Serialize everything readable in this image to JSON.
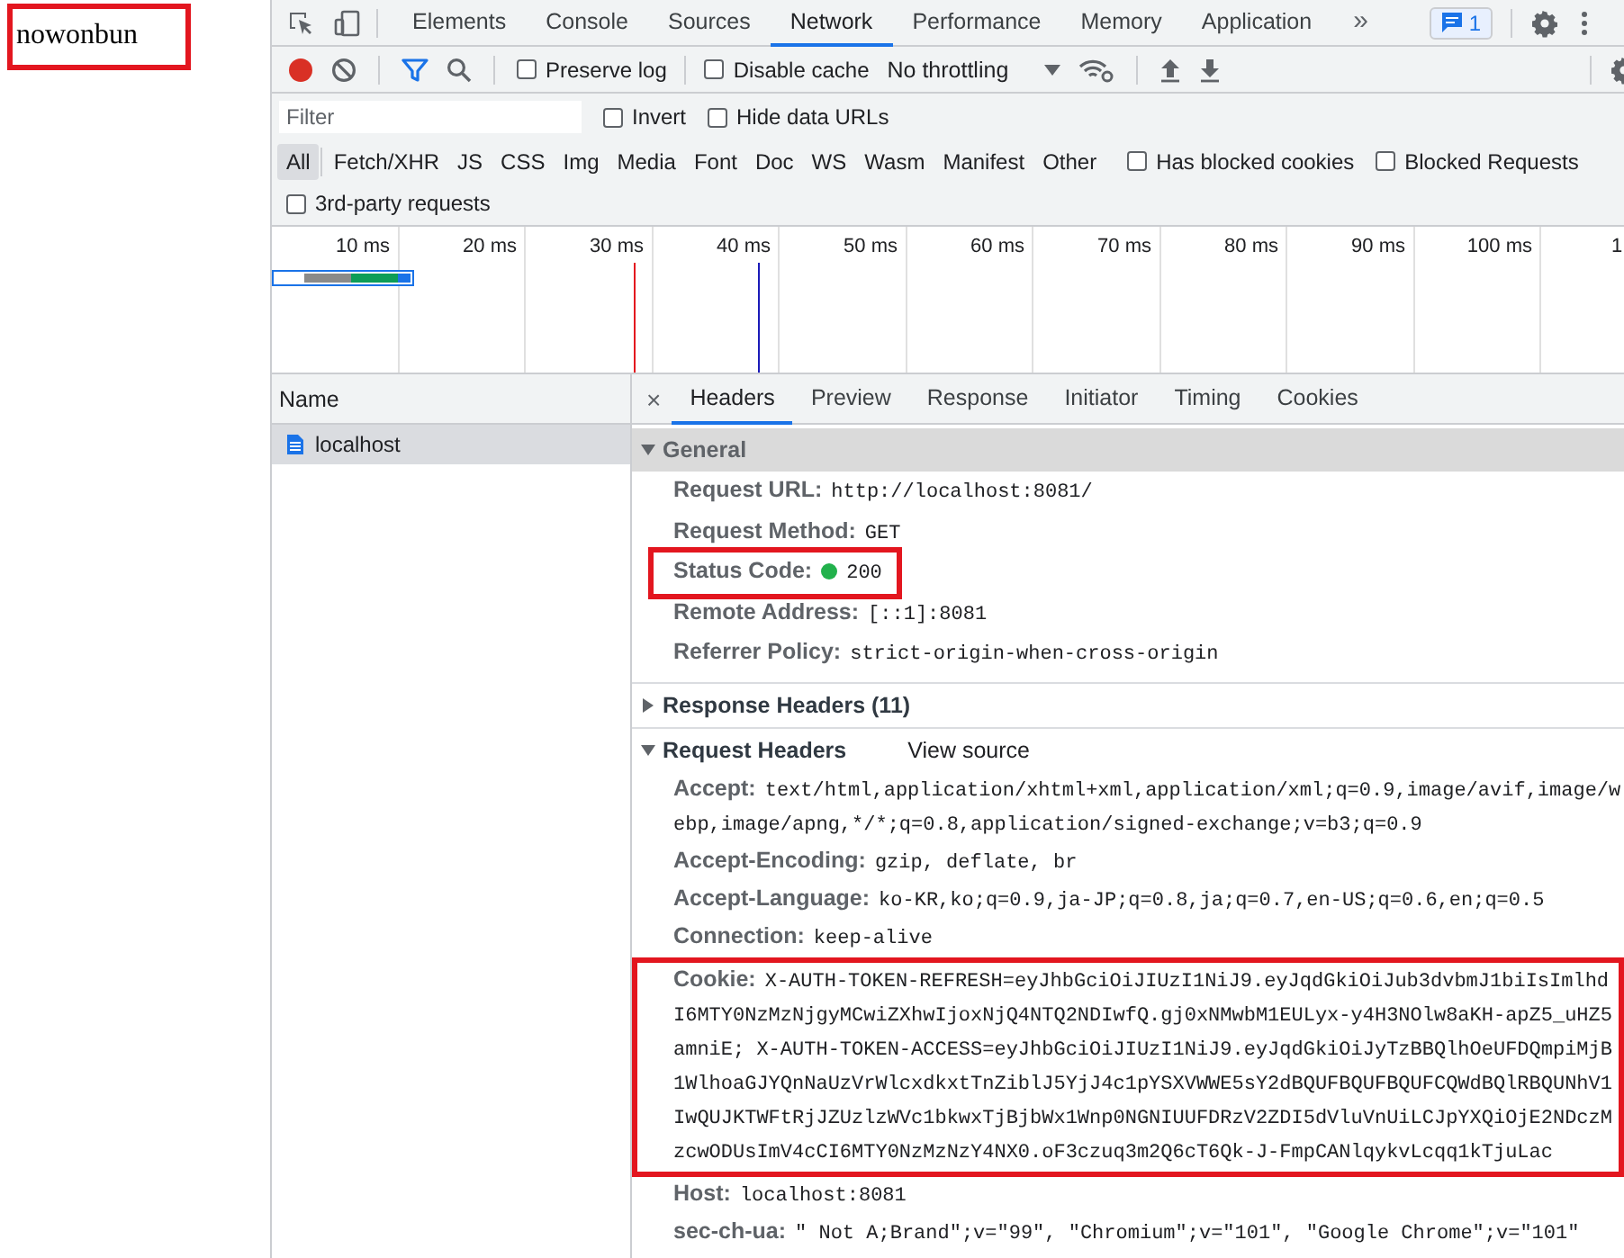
{
  "page": {
    "text": "nowonbun",
    "highlighted": true
  },
  "devtools": {
    "panel_tabs": [
      {
        "label": "Elements",
        "selected": false
      },
      {
        "label": "Console",
        "selected": false
      },
      {
        "label": "Sources",
        "selected": false
      },
      {
        "label": "Network",
        "selected": true
      },
      {
        "label": "Performance",
        "selected": false
      },
      {
        "label": "Memory",
        "selected": false
      },
      {
        "label": "Application",
        "selected": false
      }
    ],
    "more_tabs": "»",
    "issues_count": "1",
    "network_toolbar": {
      "preserve_log": {
        "label": "Preserve log",
        "checked": false
      },
      "disable_cache": {
        "label": "Disable cache",
        "checked": false
      },
      "throttling": "No throttling"
    },
    "filter_bar": {
      "placeholder": "Filter",
      "invert": {
        "label": "Invert",
        "checked": false
      },
      "hide_data_urls": {
        "label": "Hide data URLs",
        "checked": false
      }
    },
    "type_filters": [
      {
        "label": "All",
        "selected": true
      },
      {
        "label": "Fetch/XHR",
        "selected": false
      },
      {
        "label": "JS",
        "selected": false
      },
      {
        "label": "CSS",
        "selected": false
      },
      {
        "label": "Img",
        "selected": false
      },
      {
        "label": "Media",
        "selected": false
      },
      {
        "label": "Font",
        "selected": false
      },
      {
        "label": "Doc",
        "selected": false
      },
      {
        "label": "WS",
        "selected": false
      },
      {
        "label": "Wasm",
        "selected": false
      },
      {
        "label": "Manifest",
        "selected": false
      },
      {
        "label": "Other",
        "selected": false
      }
    ],
    "type_checks": [
      {
        "label": "Has blocked cookies",
        "checked": false
      },
      {
        "label": "Blocked Requests",
        "checked": false
      }
    ],
    "third_party": {
      "label": "3rd-party requests",
      "checked": false
    },
    "overview": {
      "ticks": [
        "10 ms",
        "20 ms",
        "30 ms",
        "40 ms",
        "50 ms",
        "60 ms",
        "70 ms",
        "80 ms",
        "90 ms",
        "100 ms",
        "1"
      ]
    },
    "requests": {
      "column": "Name",
      "rows": [
        {
          "name": "localhost",
          "selected": true
        }
      ]
    },
    "detail": {
      "close": "×",
      "tabs": [
        {
          "label": "Headers",
          "selected": true
        },
        {
          "label": "Preview",
          "selected": false
        },
        {
          "label": "Response",
          "selected": false
        },
        {
          "label": "Initiator",
          "selected": false
        },
        {
          "label": "Timing",
          "selected": false
        },
        {
          "label": "Cookies",
          "selected": false
        }
      ],
      "sections": [
        {
          "title": "General",
          "expanded": true,
          "selected": true,
          "rows": [
            {
              "kind": "text",
              "key": "Request URL:",
              "lines": [
                "http://localhost:8081/"
              ],
              "highlighted": false
            },
            {
              "kind": "text",
              "key": "Request Method:",
              "lines": [
                "GET"
              ],
              "highlighted": false
            },
            {
              "kind": "status",
              "key": "Status Code:",
              "lines": [
                "200"
              ],
              "color": "#22b14c",
              "highlighted": true
            },
            {
              "kind": "text",
              "key": "Remote Address:",
              "lines": [
                "[::1]:8081"
              ],
              "highlighted": false
            },
            {
              "kind": "text",
              "key": "Referrer Policy:",
              "lines": [
                "strict-origin-when-cross-origin"
              ],
              "highlighted": false
            }
          ]
        },
        {
          "title": "Response Headers (11)",
          "expanded": false,
          "selected": false
        },
        {
          "title": "Request Headers",
          "expanded": true,
          "selected": false,
          "link": "View source",
          "rows": [
            {
              "kind": "text",
              "key": "Accept:",
              "lines": [
                "text/html,application/xhtml+xml,application/xml;q=0.9,image/avif,image/w",
                "ebp,image/apng,*/*;q=0.8,application/signed-exchange;v=b3;q=0.9"
              ],
              "highlighted": false
            },
            {
              "kind": "text",
              "key": "Accept-Encoding:",
              "lines": [
                "gzip, deflate, br"
              ],
              "highlighted": false
            },
            {
              "kind": "text",
              "key": "Accept-Language:",
              "lines": [
                "ko-KR,ko;q=0.9,ja-JP;q=0.8,ja;q=0.7,en-US;q=0.6,en;q=0.5"
              ],
              "highlighted": false
            },
            {
              "kind": "text",
              "key": "Connection:",
              "lines": [
                "keep-alive"
              ],
              "highlighted": false
            },
            {
              "kind": "text",
              "key": "Cookie:",
              "lines": [
                "X-AUTH-TOKEN-REFRESH=eyJhbGciOiJIUzI1NiJ9.eyJqdGkiOiJub3dvbmJ1biIsImlhd",
                "I6MTY0NzMzNjgyMCwiZXhwIjoxNjQ4NTQ2NDIwfQ.gj0xNMwbM1EULyx-y4H3NOlw8aKH-apZ5_uHZ5",
                "amniE; X-AUTH-TOKEN-ACCESS=eyJhbGciOiJIUzI1NiJ9.eyJqdGkiOiJyTzBBQlhOeUFDQmpiMjB",
                "1WlhoaGJYQnNaUzVrWlcxdkxtTnZiblJ5YjJ4c1pYSXVWWE5sY2dBQUFBQUFBQUFCQWdBQlRBQUNhV1",
                "IwQUJKTWFtRjJZUzlzWVc1bkwxTjBjbWx1Wnp0NGNIUUFDRzV2ZDI5dVluVnUiLCJpYXQiOjE2NDczM",
                "zcwODUsImV4cCI6MTY0NzMzNzY4NX0.oF3czuq3m2Q6cT6Qk-J-FmpCANlqykvLcqq1kTjuLac"
              ],
              "highlighted": true
            },
            {
              "kind": "text",
              "key": "Host:",
              "lines": [
                "localhost:8081"
              ],
              "highlighted": false
            },
            {
              "kind": "text",
              "key": "sec-ch-ua:",
              "lines": [
                "\" Not A;Brand\";v=\"99\", \"Chromium\";v=\"101\", \"Google Chrome\";v=\"101\""
              ],
              "highlighted": false
            }
          ]
        }
      ]
    }
  }
}
